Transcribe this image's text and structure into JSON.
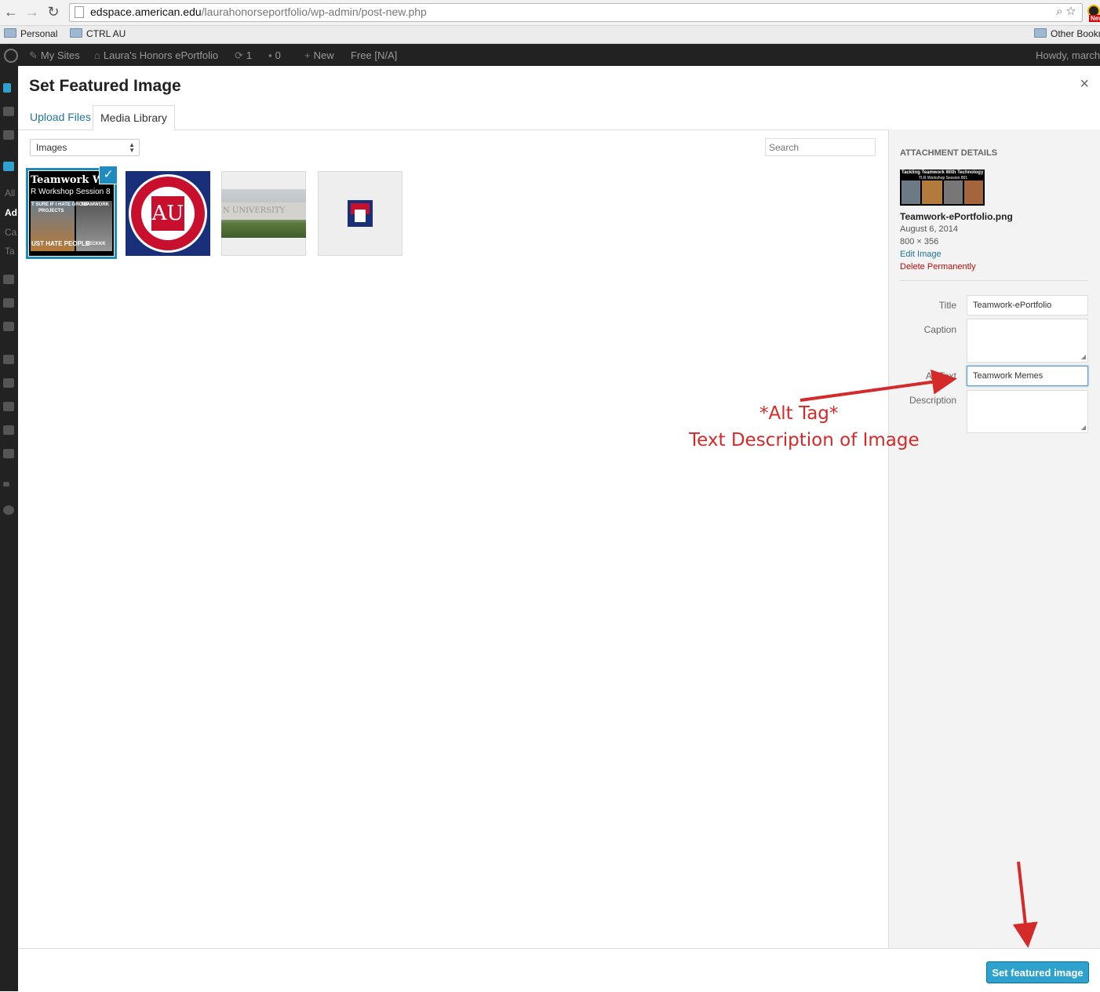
{
  "browser": {
    "url_host": "edspace.american.edu",
    "url_path": "/laurahonorseportfolio/wp-admin/post-new.php",
    "badge": "New",
    "bookmarks": [
      "Personal",
      "CTRL AU"
    ],
    "other_bookmarks": "Other Bookm"
  },
  "admin_bar": {
    "my_sites": "My Sites",
    "site_name": "Laura's Honors ePortfolio",
    "updates_count": "1",
    "comments_count": "0",
    "new_label": "New",
    "free_label": "Free [N/A]",
    "howdy": "Howdy, march"
  },
  "side_menu": [
    "All",
    "Ad",
    "Ca",
    "Ta"
  ],
  "modal": {
    "title": "Set Featured Image",
    "close": "×",
    "tabs": [
      {
        "label": "Upload Files",
        "active": false
      },
      {
        "label": "Media Library",
        "active": true
      }
    ],
    "filter_value": "Images",
    "search_placeholder": "Search",
    "thumbnails": {
      "t1_line1": "Teamwork Wit",
      "t1_line2": "R Workshop Session 8",
      "t1_meme_a": "T SURE IF I HATE GROUP",
      "t1_meme_b": "PROJECTS",
      "t1_meme_c": "TEAMWORK",
      "t1_meme_d": "UST HATE PEOPLE",
      "t1_meme_e": "NECKKK",
      "t2_letters": "AU",
      "t3_wall_text": "N UNIVERSITY"
    },
    "selected_check": "✓"
  },
  "attachment": {
    "heading": "Attachment Details",
    "thumb_title": "Tackling Teamwork With Technology",
    "thumb_sub": "TLR Workshop Session 801",
    "file_name": "Teamwork-ePortfolio.png",
    "date": "August 6, 2014",
    "dimensions": "800 × 356",
    "edit_link": "Edit Image",
    "delete_link": "Delete Permanently",
    "fields": {
      "title_label": "Title",
      "title_value": "Teamwork-ePortfolio",
      "caption_label": "Caption",
      "caption_value": "",
      "alt_label": "Alt Text",
      "alt_value": "Teamwork Memes",
      "description_label": "Description",
      "description_value": ""
    }
  },
  "annotation": {
    "line1": "*Alt Tag*",
    "line2": "Text Description of Image",
    "color": "#d42a2a"
  },
  "footer": {
    "primary_button": "Set featured image"
  }
}
